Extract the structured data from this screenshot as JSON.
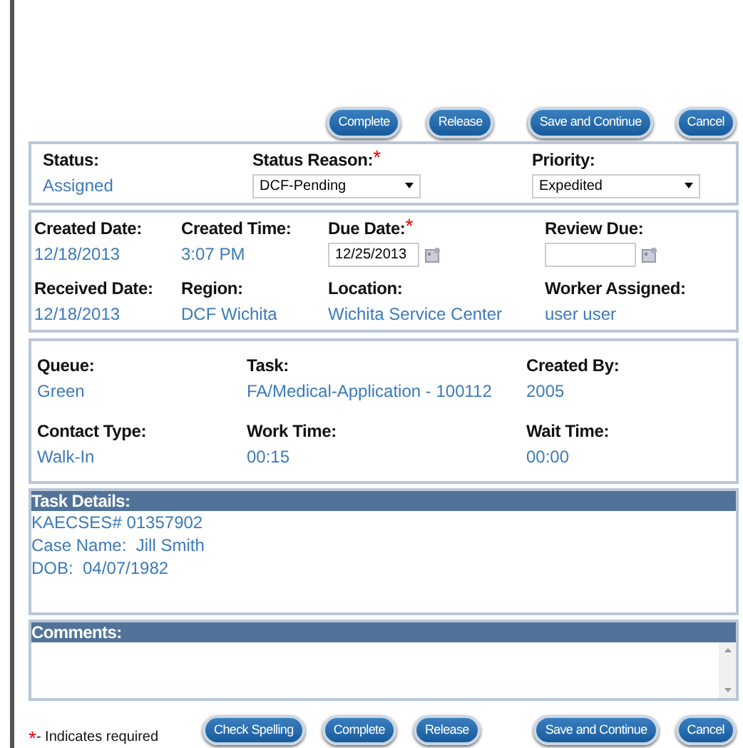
{
  "top_buttons": [
    "Complete",
    "Release",
    "Save and Continue",
    "Cancel"
  ],
  "status_section": [
    {
      "label": "Status:",
      "required": false,
      "kind": "text",
      "value": "Assigned"
    },
    {
      "label": "Status Reason:",
      "required": true,
      "kind": "select",
      "value": "DCF-Pending"
    },
    {
      "label": "Priority:",
      "required": false,
      "kind": "select",
      "value": "Expedited"
    }
  ],
  "dates_section": [
    {
      "label": "Created Date:",
      "required": false,
      "kind": "text",
      "value": "12/18/2013"
    },
    {
      "label": "Created Time:",
      "required": false,
      "kind": "text",
      "value": "3:07 PM"
    },
    {
      "label": "Due Date:",
      "required": true,
      "kind": "date",
      "value": "12/25/2013"
    },
    {
      "label": "Review Due:",
      "required": false,
      "kind": "date"
    },
    {
      "label": "Received Date:",
      "required": false,
      "kind": "text",
      "value": "12/18/2013"
    },
    {
      "label": "Region:",
      "required": false,
      "kind": "text",
      "value": "DCF Wichita"
    },
    {
      "label": "Location:",
      "required": false,
      "kind": "text",
      "value": "Wichita Service Center"
    },
    {
      "label": "Worker Assigned:",
      "required": false,
      "kind": "text",
      "value": "user user"
    }
  ],
  "task_section": [
    {
      "label": "Queue:",
      "value": "Green"
    },
    {
      "label": "Task:",
      "value": "FA/Medical-Application - 100112"
    },
    {
      "label": "Created By:",
      "value": "2005"
    },
    {
      "label": "Contact Type:",
      "value": "Walk-In"
    },
    {
      "label": "Work Time:",
      "value": "00:15"
    },
    {
      "label": "Wait Time:",
      "value": "00:00"
    }
  ],
  "task_details": {
    "title": "Task Details:",
    "lines": [
      "KAECSES# 01357902",
      "Case Name:  Jill Smith",
      "DOB:  04/07/1982"
    ]
  },
  "comments": {
    "title": "Comments:"
  },
  "required_mark": "*",
  "required_note": "- Indicates required",
  "bottom_buttons": [
    "Check Spelling",
    "Complete",
    "Release",
    "Save and Continue",
    "Cancel"
  ]
}
